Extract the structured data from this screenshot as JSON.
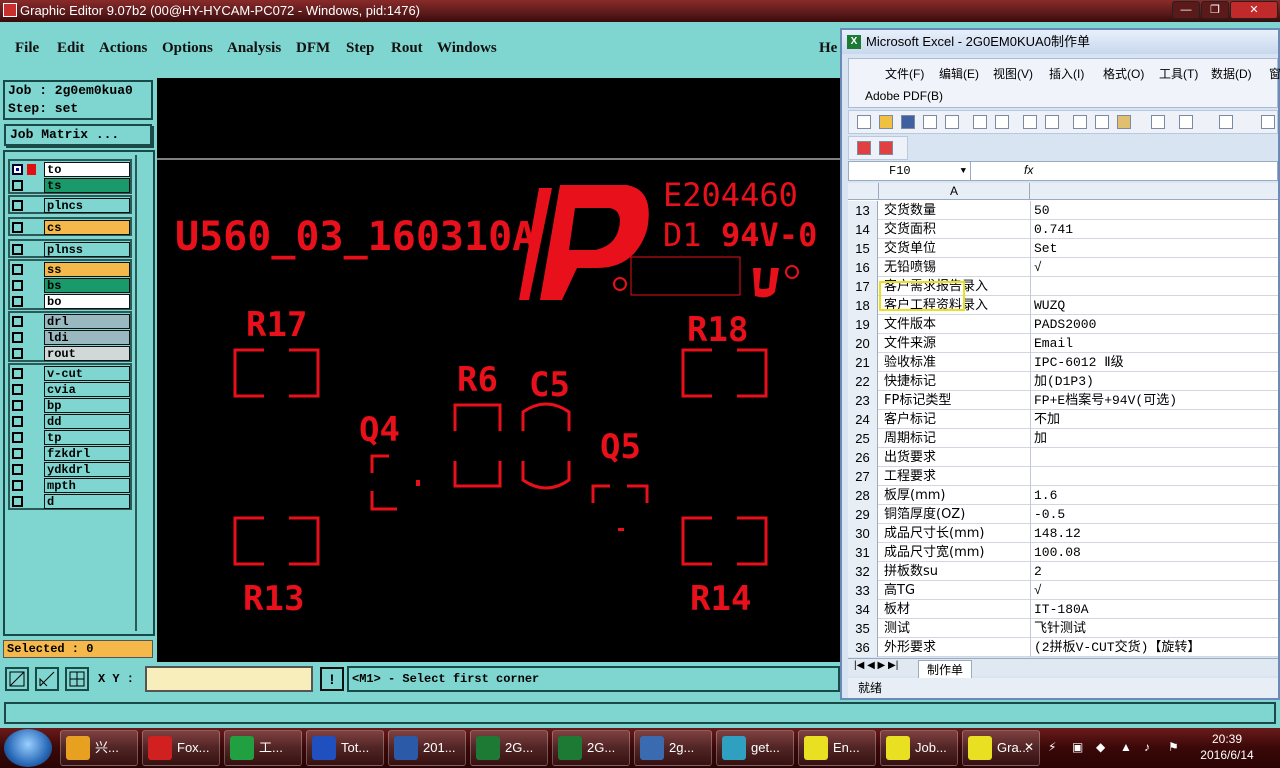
{
  "editor": {
    "title": "Graphic Editor 9.07b2 (00@HY-HYCAM-PC072 - Windows, pid:1476)",
    "menus": [
      "File",
      "Edit",
      "Actions",
      "Options",
      "Analysis",
      "DFM",
      "Step",
      "Rout",
      "Windows",
      "He"
    ],
    "job_label": "Job : 2g0em0kua0",
    "step_label": "Step: set",
    "job_matrix_label": "Job Matrix ...",
    "selected_label": "Selected : 0",
    "xy_label": "X Y :",
    "xy_value": "",
    "status_message": "<M1> - Select first corner",
    "exclaim": "!"
  },
  "layers": [
    {
      "name": "to",
      "color": "#ffffff",
      "on": true,
      "swatch": "#e01010"
    },
    {
      "name": "ts",
      "color": "#1a9a6a",
      "on": false,
      "swatch": ""
    },
    {
      "name": "plncs",
      "color": "#7fd5cf",
      "on": false,
      "swatch": ""
    },
    {
      "name": "cs",
      "color": "#f5b84a",
      "on": false,
      "swatch": ""
    },
    {
      "name": "plnss",
      "color": "#7fd5cf",
      "on": false,
      "swatch": ""
    },
    {
      "name": "ss",
      "color": "#f5b84a",
      "on": false,
      "swatch": ""
    },
    {
      "name": "bs",
      "color": "#1a9a6a",
      "on": false,
      "swatch": ""
    },
    {
      "name": "bo",
      "color": "#ffffff",
      "on": false,
      "swatch": ""
    },
    {
      "name": "drl",
      "color": "#9ab8c0",
      "on": false,
      "swatch": ""
    },
    {
      "name": "ldi",
      "color": "#9ab8c0",
      "on": false,
      "swatch": ""
    },
    {
      "name": "rout",
      "color": "#d0d8d8",
      "on": false,
      "swatch": ""
    },
    {
      "name": "v-cut",
      "color": "#7fd5cf",
      "on": false,
      "swatch": ""
    },
    {
      "name": "cvia",
      "color": "#7fd5cf",
      "on": false,
      "swatch": ""
    },
    {
      "name": "bp",
      "color": "#7fd5cf",
      "on": false,
      "swatch": ""
    },
    {
      "name": "dd",
      "color": "#7fd5cf",
      "on": false,
      "swatch": ""
    },
    {
      "name": "tp",
      "color": "#7fd5cf",
      "on": false,
      "swatch": ""
    },
    {
      "name": "fzkdrl",
      "color": "#7fd5cf",
      "on": false,
      "swatch": ""
    },
    {
      "name": "ydkdrl",
      "color": "#7fd5cf",
      "on": false,
      "swatch": ""
    },
    {
      "name": "mpth",
      "color": "#7fd5cf",
      "on": false,
      "swatch": ""
    },
    {
      "name": "d",
      "color": "#7fd5cf",
      "on": false,
      "swatch": ""
    }
  ],
  "board": {
    "color": "#e8101a",
    "part_number": "U560_03_160310A",
    "ul_file": "E204460",
    "ul_rating_d": "D1",
    "ul_rating": "94V-0",
    "labels": [
      "R17",
      "R18",
      "R6",
      "C5",
      "Q4",
      "Q5",
      "R13",
      "R14"
    ]
  },
  "excel": {
    "title": "Microsoft Excel - 2G0EM0KUA0制作单",
    "menus": [
      "文件(F)",
      "编辑(E)",
      "视图(V)",
      "插入(I)",
      "格式(O)",
      "工具(T)",
      "数据(D)",
      "窗"
    ],
    "adobe_menu": "Adobe PDF(B)",
    "namebox": "F10",
    "fx": "fx",
    "column_a": "A",
    "rows": [
      {
        "n": "13",
        "a": "交货数量",
        "b": "50"
      },
      {
        "n": "14",
        "a": "交货面积",
        "b": "0.741"
      },
      {
        "n": "15",
        "a": "交货单位",
        "b": "Set"
      },
      {
        "n": "16",
        "a": "无铅喷锡",
        "b": "√"
      },
      {
        "n": "17",
        "a": "客户需求报告录入",
        "b": ""
      },
      {
        "n": "18",
        "a": "客户工程资料录入",
        "b": "WUZQ"
      },
      {
        "n": "19",
        "a": "文件版本",
        "b": "PADS2000"
      },
      {
        "n": "20",
        "a": "文件来源",
        "b": "Email"
      },
      {
        "n": "21",
        "a": "验收标准",
        "b": "IPC-6012 Ⅱ级"
      },
      {
        "n": "22",
        "a": "快捷标记",
        "b": "加(D1P3)"
      },
      {
        "n": "23",
        "a": "FP标记类型",
        "b": "FP+E档案号+94V(可选)"
      },
      {
        "n": "24",
        "a": "客户标记",
        "b": "不加"
      },
      {
        "n": "25",
        "a": "周期标记",
        "b": "加"
      },
      {
        "n": "26",
        "a": "出货要求",
        "b": ""
      },
      {
        "n": "27",
        "a": "工程要求",
        "b": ""
      },
      {
        "n": "28",
        "a": "板厚(mm)",
        "b": "1.6"
      },
      {
        "n": "29",
        "a": "铜箔厚度(OZ)",
        "b": "-0.5"
      },
      {
        "n": "30",
        "a": "成品尺寸长(mm)",
        "b": "148.12"
      },
      {
        "n": "31",
        "a": "成品尺寸宽(mm)",
        "b": "100.08"
      },
      {
        "n": "32",
        "a": "拼板数su",
        "b": "2"
      },
      {
        "n": "33",
        "a": "高TG",
        "b": "√"
      },
      {
        "n": "34",
        "a": "板材",
        "b": "IT-180A"
      },
      {
        "n": "35",
        "a": "测试",
        "b": "飞针测试"
      },
      {
        "n": "36",
        "a": "外形要求",
        "b": "(2拼板V-CUT交货)【旋转】"
      }
    ],
    "sheet_tab": "制作单",
    "status": "就绪"
  },
  "taskbar": {
    "tasks": [
      {
        "label": "兴...",
        "color": "#e8a020"
      },
      {
        "label": "Fox...",
        "color": "#d02020"
      },
      {
        "label": "工...",
        "color": "#20a040"
      },
      {
        "label": "Tot...",
        "color": "#2050c0"
      },
      {
        "label": "201...",
        "color": "#2a5aa8"
      },
      {
        "label": "2G...",
        "color": "#1d7a35"
      },
      {
        "label": "2G...",
        "color": "#1d7a35"
      },
      {
        "label": "2g...",
        "color": "#3a6ab0"
      },
      {
        "label": "get...",
        "color": "#30a0c0"
      },
      {
        "label": "En...",
        "color": "#e8e020"
      },
      {
        "label": "Job...",
        "color": "#e8e020"
      },
      {
        "label": "Gra...",
        "color": "#e8e020"
      }
    ],
    "time": "20:39",
    "date": "2016/6/14"
  }
}
